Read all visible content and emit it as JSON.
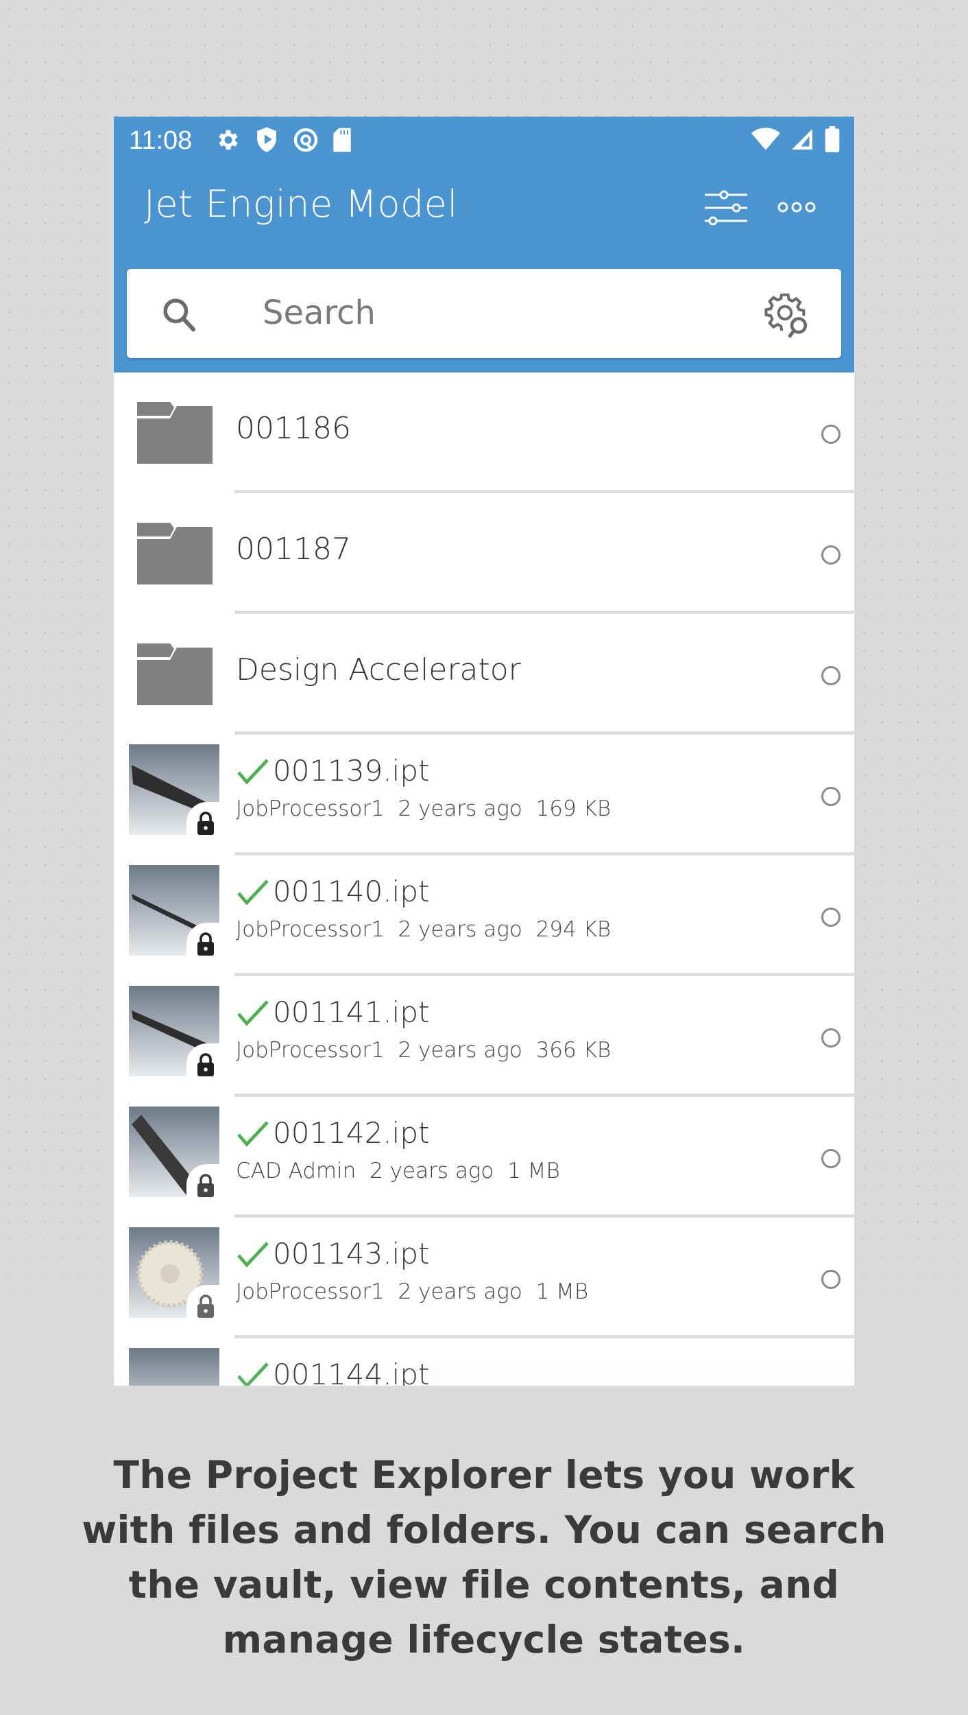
{
  "status_bar": {
    "time": "11:08",
    "left_icons": [
      "settings-icon",
      "play-protect-icon",
      "at-sign-icon",
      "sd-card-icon"
    ],
    "right_icons": [
      "wifi-icon",
      "cellular-signal-icon",
      "battery-icon"
    ]
  },
  "app_bar": {
    "title": "Jet Engine Model",
    "actions": [
      "filter-sliders-icon",
      "more-options-icon"
    ]
  },
  "search": {
    "placeholder": "Search",
    "value": ""
  },
  "list": {
    "folders": [
      {
        "name": "001186"
      },
      {
        "name": "001187"
      },
      {
        "name": "Design Accelerator"
      }
    ],
    "files": [
      {
        "name": "001139.ipt",
        "author": "JobProcessor1",
        "modified": "2 years ago",
        "size": "169 KB",
        "locked": true,
        "checked_in": true
      },
      {
        "name": "001140.ipt",
        "author": "JobProcessor1",
        "modified": "2 years ago",
        "size": "294 KB",
        "locked": true,
        "checked_in": true
      },
      {
        "name": "001141.ipt",
        "author": "JobProcessor1",
        "modified": "2 years ago",
        "size": "366 KB",
        "locked": true,
        "checked_in": true
      },
      {
        "name": "001142.ipt",
        "author": "CAD Admin",
        "modified": "2 years ago",
        "size": "1 MB",
        "locked": true,
        "checked_in": true
      },
      {
        "name": "001143.ipt",
        "author": "JobProcessor1",
        "modified": "2 years ago",
        "size": "1 MB",
        "locked": true,
        "checked_in": true
      },
      {
        "name": "001144.ipt",
        "author": "",
        "modified": "",
        "size": "",
        "locked": false,
        "checked_in": true
      }
    ]
  },
  "caption": "The Project Explorer lets you work with files and folders. You can search the vault, view file contents, and manage lifecycle states.",
  "colors": {
    "app_bar": "#4a94d2",
    "check_green": "#4caf50",
    "folder_gray": "#808080",
    "page_background": "#dadada"
  }
}
